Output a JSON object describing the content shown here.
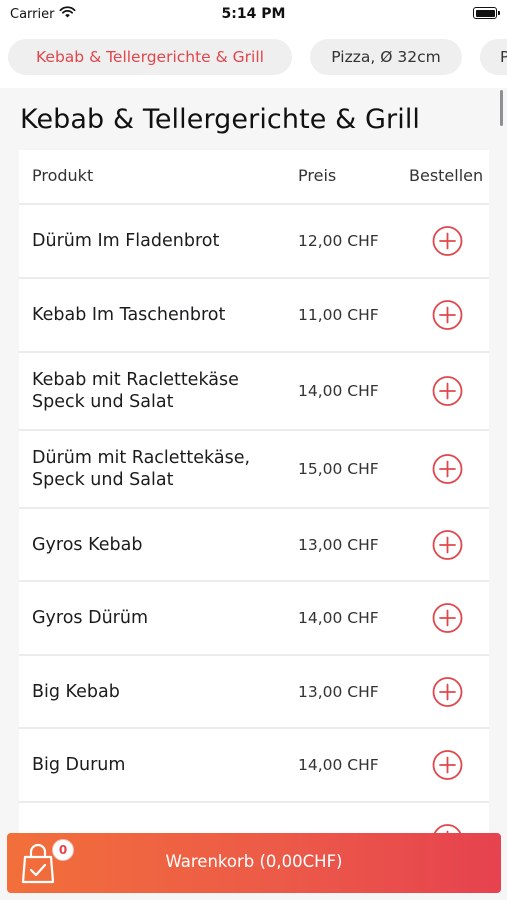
{
  "status_bar": {
    "carrier": "Carrier",
    "time": "5:14 PM",
    "wifi_icon": "wifi-icon",
    "battery_icon": "battery-icon"
  },
  "tabs": [
    {
      "label": "Kebab & Tellergerichte & Grill",
      "active": true
    },
    {
      "label": "Pizza, Ø 32cm",
      "active": false
    },
    {
      "label": "P",
      "active": false
    }
  ],
  "section": {
    "title": "Kebab & Tellergerichte & Grill"
  },
  "table": {
    "headers": {
      "product": "Produkt",
      "price": "Preis",
      "order": "Bestellen"
    },
    "rows": [
      {
        "name": "Dürüm Im Fladenbrot",
        "price": "12,00 CHF"
      },
      {
        "name": "Kebab Im Taschenbrot",
        "price": "11,00 CHF"
      },
      {
        "name": "Kebab mit Raclettekäse Speck und Salat",
        "price": "14,00 CHF"
      },
      {
        "name": "Dürüm mit Raclettekäse, Speck und Salat",
        "price": "15,00 CHF"
      },
      {
        "name": "Gyros Kebab",
        "price": "13,00 CHF"
      },
      {
        "name": "Gyros Dürüm",
        "price": "14,00 CHF"
      },
      {
        "name": "Big Kebab",
        "price": "13,00 CHF"
      },
      {
        "name": "Big Durum",
        "price": "14,00 CHF"
      }
    ],
    "add_icon": "plus-circle-icon"
  },
  "cart": {
    "label": "Warenkorb (0,00CHF)",
    "badge_count": "0",
    "icon": "shopping-bag-icon"
  },
  "colors": {
    "accent": "#e0474c",
    "cart_gradient_start": "#f26f3a",
    "cart_gradient_end": "#e6424f",
    "tab_background": "#efefef",
    "content_background": "#f6f6f7"
  }
}
